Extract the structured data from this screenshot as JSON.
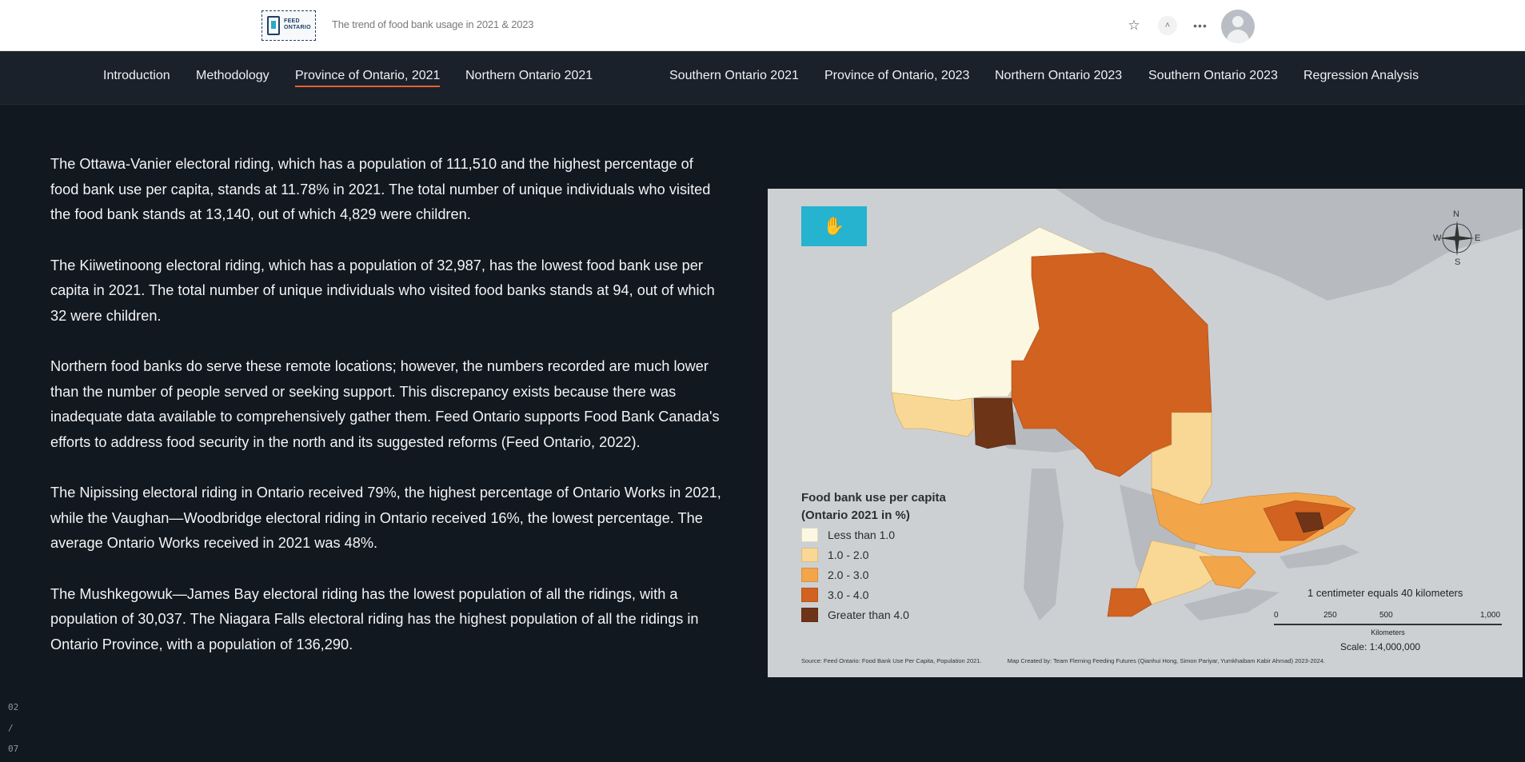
{
  "header": {
    "logo_text": "FEED ONTARIO",
    "site_title": "The trend of food bank usage in 2021 & 2023",
    "icons": [
      "star-icon",
      "chevron-up-icon",
      "more-icon",
      "avatar"
    ]
  },
  "nav": {
    "items": [
      "Introduction",
      "Methodology",
      "Province of Ontario, 2021",
      "Northern Ontario 2021",
      "Southern Ontario 2021",
      "Province of Ontario, 2023",
      "Northern Ontario 2023",
      "Southern Ontario 2023",
      "Regression Analysis"
    ],
    "active": "Province of Ontario, 2021"
  },
  "content": {
    "paragraphs": [
      "The Ottawa-Vanier electoral riding, which has a population of 111,510 and the highest percentage of food bank use per capita, stands at 11.78% in 2021. The total number of unique individuals who visited the food bank stands at 13,140, out of which 4,829 were children.",
      "The Kiiwetinoong electoral riding, which has a population of 32,987, has the lowest food bank use per capita in 2021. The total number of unique individuals who visited food banks stands at 94, out of which 32 were children.",
      "Northern food banks do serve these remote locations; however, the numbers recorded are much lower than the number of people served or seeking support. This discrepancy exists because there was inadequate data available to comprehensively gather them. Feed Ontario supports Food Bank Canada's efforts to address food security in the north and its suggested reforms (Feed Ontario, 2022).",
      "The Nipissing electoral riding in Ontario received 79%, the highest percentage of Ontario Works in 2021, while the Vaughan—Woodbridge electoral riding in Ontario received 16%, the lowest percentage. The average Ontario Works received in 2021 was 48%.",
      "The Mushkegowuk—James Bay electoral riding has the lowest population of all the ridings, with a population of 30,037. The Niagara Falls electoral riding has the highest population of all the ridings in Ontario Province, with a population of 136,290."
    ]
  },
  "pager": {
    "current": "02",
    "sep": "/",
    "total": "07"
  },
  "map": {
    "legend_title_1": "Food bank use per capita",
    "legend_title_2": "(Ontario 2021 in %)",
    "legend": [
      {
        "label": "Less than 1.0",
        "color": "#fbf7e1"
      },
      {
        "label": "1.0 - 2.0",
        "color": "#f8d894"
      },
      {
        "label": "2.0 - 3.0",
        "color": "#f3a54a"
      },
      {
        "label": "3.0 - 4.0",
        "color": "#d1621f"
      },
      {
        "label": "Greater than 4.0",
        "color": "#6e3418"
      }
    ],
    "scale_text": "1 centimeter equals 40 kilometers",
    "scale_ticks": [
      "0",
      "250",
      "500",
      "1,000"
    ],
    "scale_unit": "Kilometers",
    "scale_ratio": "Scale: 1:4,000,000",
    "source": "Source: Feed Ontario: Food Bank Use Per Capita, Population 2021.",
    "credit": "Map Created by: Team Fleming Feeding Futures (Qianhui Hong, Simon Pariyar, Yumkhaibam Kabir Ahmad) 2023-2024.",
    "compass": {
      "n": "N",
      "s": "S",
      "e": "E",
      "w": "W"
    }
  }
}
